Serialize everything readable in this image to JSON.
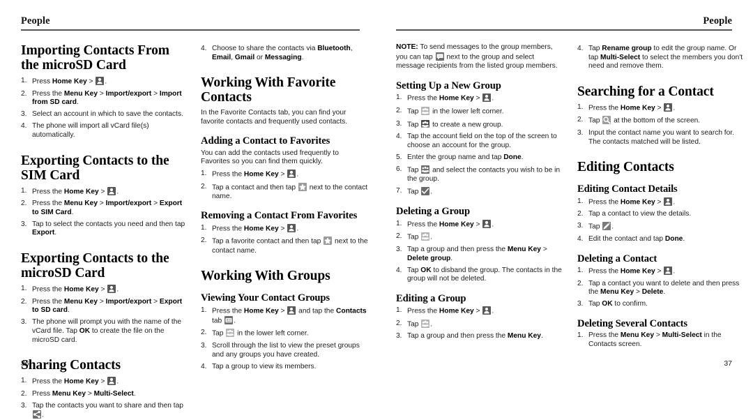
{
  "document": {
    "running_head_left": "People",
    "running_head_right": "People",
    "folio_left": "36",
    "folio_right": "37"
  },
  "icons": {
    "contacts": "contacts-icon",
    "star": "star-icon",
    "contacts_tab": "contacts-tab-icon",
    "group": "group-icon",
    "group_add": "group-add-icon",
    "group_select": "group-select-icon",
    "message": "message-icon",
    "check": "check-icon",
    "search": "search-icon",
    "edit": "edit-icon",
    "share": "share-icon"
  },
  "page36": {
    "col1": {
      "s1": {
        "heading": "Importing Contacts From the microSD Card",
        "steps": [
          {
            "parts": [
              {
                "t": "Press "
              },
              {
                "t": "Home Key",
                "b": true
              },
              {
                "t": " > "
              },
              {
                "icon": "contacts"
              },
              {
                "t": "."
              }
            ]
          },
          {
            "parts": [
              {
                "t": "Press the "
              },
              {
                "t": "Menu Key",
                "b": true
              },
              {
                "t": " > "
              },
              {
                "t": "Import/export",
                "b": true
              },
              {
                "t": " > "
              },
              {
                "t": "Import from SD card",
                "b": true
              },
              {
                "t": "."
              }
            ]
          },
          {
            "parts": [
              {
                "t": "Select an account in which to save the contacts."
              }
            ]
          },
          {
            "parts": [
              {
                "t": "The phone will import all vCard file(s) automatically."
              }
            ]
          }
        ]
      },
      "s2": {
        "heading": "Exporting Contacts to the SIM Card",
        "steps": [
          {
            "parts": [
              {
                "t": "Press the "
              },
              {
                "t": "Home Key",
                "b": true
              },
              {
                "t": " > "
              },
              {
                "icon": "contacts"
              },
              {
                "t": "."
              }
            ]
          },
          {
            "parts": [
              {
                "t": "Press the "
              },
              {
                "t": "Menu Key",
                "b": true
              },
              {
                "t": " > "
              },
              {
                "t": "Import/export",
                "b": true
              },
              {
                "t": " > "
              },
              {
                "t": "Export to SIM Card",
                "b": true
              },
              {
                "t": "."
              }
            ]
          },
          {
            "parts": [
              {
                "t": "Tap to select the contacts you need and then tap "
              },
              {
                "t": "Export",
                "b": true
              },
              {
                "t": "."
              }
            ]
          }
        ]
      },
      "s3": {
        "heading": "Exporting Contacts to the microSD Card",
        "steps": [
          {
            "parts": [
              {
                "t": "Press the "
              },
              {
                "t": "Home Key",
                "b": true
              },
              {
                "t": " > "
              },
              {
                "icon": "contacts"
              },
              {
                "t": "."
              }
            ]
          },
          {
            "parts": [
              {
                "t": "Press the "
              },
              {
                "t": "Menu Key",
                "b": true
              },
              {
                "t": " > "
              },
              {
                "t": "Import/export",
                "b": true
              },
              {
                "t": " > "
              },
              {
                "t": "Export to SD card",
                "b": true
              },
              {
                "t": "."
              }
            ]
          },
          {
            "parts": [
              {
                "t": "The phone will prompt you with the name of the vCard file. Tap "
              },
              {
                "t": "OK",
                "b": true
              },
              {
                "t": " to create the file on the microSD card."
              }
            ]
          }
        ]
      },
      "s4": {
        "heading": "Sharing Contacts",
        "steps": [
          {
            "parts": [
              {
                "t": "Press the "
              },
              {
                "t": "Home Key",
                "b": true
              },
              {
                "t": " > "
              },
              {
                "icon": "contacts"
              },
              {
                "t": "."
              }
            ]
          },
          {
            "parts": [
              {
                "t": "Press "
              },
              {
                "t": "Menu Key",
                "b": true
              },
              {
                "t": " > "
              },
              {
                "t": "Multi-Select",
                "b": true
              },
              {
                "t": "."
              }
            ]
          },
          {
            "parts": [
              {
                "t": "Tap the contacts you want to share and then tap "
              },
              {
                "icon": "share"
              },
              {
                "t": "."
              }
            ]
          }
        ]
      }
    },
    "col2": {
      "carryover": {
        "number": "4.",
        "parts": [
          {
            "t": "Choose to share the contacts via "
          },
          {
            "t": "Bluetooth",
            "b": true
          },
          {
            "t": ", "
          },
          {
            "t": "Email",
            "b": true
          },
          {
            "t": ", "
          },
          {
            "t": "Gmail",
            "b": true
          },
          {
            "t": " or "
          },
          {
            "t": "Messaging",
            "b": true
          },
          {
            "t": "."
          }
        ]
      },
      "s1": {
        "heading": "Working With Favorite Contacts",
        "intro": "In the Favorite Contacts tab, you can find your favorite contacts and frequently used contacts."
      },
      "s2": {
        "heading": "Adding a Contact to Favorites",
        "intro": "You can add the contacts used frequently to Favorites so you can find them quickly.",
        "steps": [
          {
            "parts": [
              {
                "t": "Press the "
              },
              {
                "t": "Home Key",
                "b": true
              },
              {
                "t": " > "
              },
              {
                "icon": "contacts"
              },
              {
                "t": "."
              }
            ]
          },
          {
            "parts": [
              {
                "t": "Tap a contact and then tap "
              },
              {
                "icon": "star"
              },
              {
                "t": " next to the contact name."
              }
            ]
          }
        ]
      },
      "s3": {
        "heading": "Removing a Contact From Favorites",
        "steps": [
          {
            "parts": [
              {
                "t": "Press the "
              },
              {
                "t": "Home Key",
                "b": true
              },
              {
                "t": " > "
              },
              {
                "icon": "contacts"
              },
              {
                "t": "."
              }
            ]
          },
          {
            "parts": [
              {
                "t": "Tap a favorite contact and then tap "
              },
              {
                "icon": "star"
              },
              {
                "t": " next to the contact name."
              }
            ]
          }
        ]
      },
      "s4": {
        "heading": "Working With Groups"
      },
      "s5": {
        "heading": "Viewing Your Contact Groups",
        "steps": [
          {
            "parts": [
              {
                "t": "Press the "
              },
              {
                "t": "Home Key",
                "b": true
              },
              {
                "t": " > "
              },
              {
                "icon": "contacts"
              },
              {
                "t": " and tap the "
              },
              {
                "t": "Contacts",
                "b": true
              },
              {
                "t": " tab "
              },
              {
                "icon": "contacts_tab"
              },
              {
                "t": "."
              }
            ]
          },
          {
            "parts": [
              {
                "t": "Tap "
              },
              {
                "icon": "group"
              },
              {
                "t": " in the lower left corner."
              }
            ]
          },
          {
            "parts": [
              {
                "t": "Scroll through the list to view the preset groups and any groups you have created."
              }
            ]
          },
          {
            "parts": [
              {
                "t": "Tap a group to view its members."
              }
            ]
          }
        ]
      }
    }
  },
  "page37": {
    "col1": {
      "note": {
        "label": "NOTE:",
        "parts": [
          {
            "t": " To send messages to the group members, you can tap "
          },
          {
            "icon": "message"
          },
          {
            "t": " next to the group and select message recipients from the listed group members."
          }
        ]
      },
      "s1": {
        "heading": "Setting Up a New Group",
        "steps": [
          {
            "parts": [
              {
                "t": "Press the "
              },
              {
                "t": "Home Key",
                "b": true
              },
              {
                "t": " > "
              },
              {
                "icon": "contacts"
              },
              {
                "t": "."
              }
            ]
          },
          {
            "parts": [
              {
                "t": "Tap "
              },
              {
                "icon": "group"
              },
              {
                "t": " in the lower left corner."
              }
            ]
          },
          {
            "parts": [
              {
                "t": "Tap "
              },
              {
                "icon": "group_add"
              },
              {
                "t": " to create a new group."
              }
            ]
          },
          {
            "parts": [
              {
                "t": "Tap the account field on the top of the screen to choose an account for the group."
              }
            ]
          },
          {
            "parts": [
              {
                "t": "Enter the group name and tap "
              },
              {
                "t": "Done",
                "b": true
              },
              {
                "t": "."
              }
            ]
          },
          {
            "parts": [
              {
                "t": "Tap "
              },
              {
                "icon": "group_select"
              },
              {
                "t": " and select the contacts you wish to be in the group."
              }
            ]
          },
          {
            "parts": [
              {
                "t": "Tap "
              },
              {
                "icon": "check"
              },
              {
                "t": "."
              }
            ]
          }
        ]
      },
      "s2": {
        "heading": "Deleting a Group",
        "steps": [
          {
            "parts": [
              {
                "t": "Press the "
              },
              {
                "t": "Home Key",
                "b": true
              },
              {
                "t": " > "
              },
              {
                "icon": "contacts"
              },
              {
                "t": "."
              }
            ]
          },
          {
            "parts": [
              {
                "t": "Tap "
              },
              {
                "icon": "group"
              },
              {
                "t": "."
              }
            ]
          },
          {
            "parts": [
              {
                "t": "Tap a group and then press the "
              },
              {
                "t": "Menu Key",
                "b": true
              },
              {
                "t": " > "
              },
              {
                "t": "Delete group",
                "b": true
              },
              {
                "t": "."
              }
            ]
          },
          {
            "parts": [
              {
                "t": "Tap "
              },
              {
                "t": "OK",
                "b": true
              },
              {
                "t": " to disband the group. The contacts in the group will not be deleted."
              }
            ]
          }
        ]
      },
      "s3": {
        "heading": "Editing a Group",
        "steps": [
          {
            "parts": [
              {
                "t": "Press the "
              },
              {
                "t": "Home Key",
                "b": true
              },
              {
                "t": " > "
              },
              {
                "icon": "contacts"
              },
              {
                "t": "."
              }
            ]
          },
          {
            "parts": [
              {
                "t": "Tap "
              },
              {
                "icon": "group"
              },
              {
                "t": "."
              }
            ]
          },
          {
            "parts": [
              {
                "t": "Tap a group and then press the "
              },
              {
                "t": "Menu Key",
                "b": true
              },
              {
                "t": "."
              }
            ]
          }
        ]
      }
    },
    "col2": {
      "carryover": {
        "number": "4.",
        "parts": [
          {
            "t": "Tap "
          },
          {
            "t": "Rename group",
            "b": true
          },
          {
            "t": " to edit the group name. Or tap "
          },
          {
            "t": "Multi-Select",
            "b": true
          },
          {
            "t": " to select the members you don't need and remove them."
          }
        ]
      },
      "s1": {
        "heading": "Searching for a Contact",
        "steps": [
          {
            "parts": [
              {
                "t": "Press the "
              },
              {
                "t": "Home Key",
                "b": true
              },
              {
                "t": " > "
              },
              {
                "icon": "contacts"
              },
              {
                "t": "."
              }
            ]
          },
          {
            "parts": [
              {
                "t": "Tap "
              },
              {
                "icon": "search"
              },
              {
                "t": " at the bottom of the screen."
              }
            ]
          },
          {
            "parts": [
              {
                "t": "Input the contact name you want to search for. The contacts matched will be listed."
              }
            ]
          }
        ]
      },
      "s2": {
        "heading": "Editing Contacts"
      },
      "s3": {
        "heading": "Editing Contact Details",
        "steps": [
          {
            "parts": [
              {
                "t": "Press the "
              },
              {
                "t": "Home Key",
                "b": true
              },
              {
                "t": " > "
              },
              {
                "icon": "contacts"
              },
              {
                "t": "."
              }
            ]
          },
          {
            "parts": [
              {
                "t": "Tap a contact to view the details."
              }
            ]
          },
          {
            "parts": [
              {
                "t": "Tap "
              },
              {
                "icon": "edit"
              },
              {
                "t": "."
              }
            ]
          },
          {
            "parts": [
              {
                "t": "Edit the contact and tap "
              },
              {
                "t": "Done",
                "b": true
              },
              {
                "t": "."
              }
            ]
          }
        ]
      },
      "s4": {
        "heading": "Deleting a Contact",
        "steps": [
          {
            "parts": [
              {
                "t": "Press the "
              },
              {
                "t": "Home Key",
                "b": true
              },
              {
                "t": " > "
              },
              {
                "icon": "contacts"
              },
              {
                "t": "."
              }
            ]
          },
          {
            "parts": [
              {
                "t": "Tap a contact you want to delete and then press the "
              },
              {
                "t": "Menu Key",
                "b": true
              },
              {
                "t": " > "
              },
              {
                "t": "Delete",
                "b": true
              },
              {
                "t": "."
              }
            ]
          },
          {
            "parts": [
              {
                "t": "Tap "
              },
              {
                "t": "OK",
                "b": true
              },
              {
                "t": " to confirm."
              }
            ]
          }
        ]
      },
      "s5": {
        "heading": "Deleting Several Contacts",
        "steps": [
          {
            "parts": [
              {
                "t": "Press the "
              },
              {
                "t": "Menu Key",
                "b": true
              },
              {
                "t": " > "
              },
              {
                "t": "Multi-Select",
                "b": true
              },
              {
                "t": " in the Contacts screen."
              }
            ]
          }
        ]
      }
    }
  }
}
